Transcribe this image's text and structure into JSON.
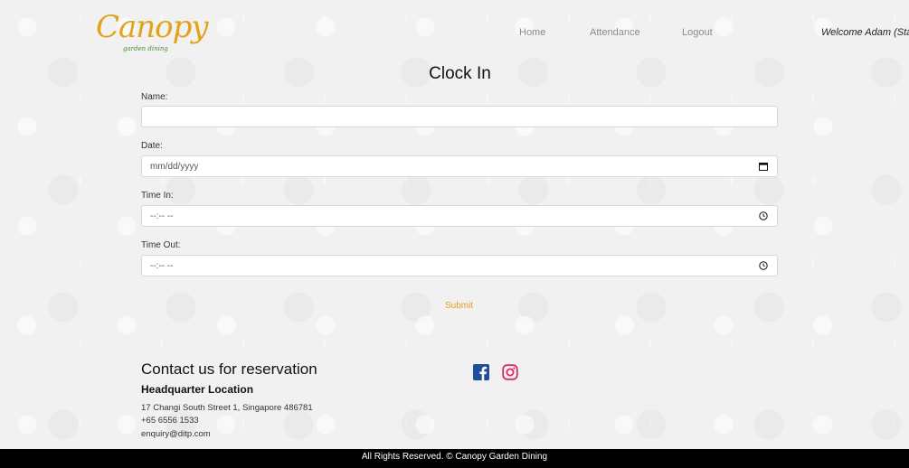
{
  "brand": {
    "logo_text": "Canopy",
    "logo_subtext": "garden dining"
  },
  "nav": {
    "items": [
      {
        "label": "Home"
      },
      {
        "label": "Attendance"
      },
      {
        "label": "Logout"
      }
    ],
    "welcome": "Welcome Adam (Staff"
  },
  "form": {
    "title": "Clock In",
    "name": {
      "label": "Name:",
      "value": ""
    },
    "date": {
      "label": "Date:",
      "placeholder": "mm/dd/yyyy",
      "icon": "calendar-icon"
    },
    "time_in": {
      "label": "Time In:",
      "placeholder": "--:-- --",
      "icon": "clock-icon"
    },
    "time_out": {
      "label": "Time Out:",
      "placeholder": "--:-- --",
      "icon": "clock-icon"
    },
    "submit_label": "Submit"
  },
  "contact": {
    "title": "Contact us for reservation",
    "hq_title": "Headquarter Location",
    "address": "17 Changi South Street 1, Singapore 486781",
    "phone": "+65 6556 1533",
    "email": "enquiry@ditp.com",
    "social": [
      "facebook-icon",
      "instagram-icon"
    ]
  },
  "footer": {
    "text": "All Rights Reserved. © Canopy Garden Dining"
  },
  "colors": {
    "accent": "#e3a020",
    "facebook": "#1f4f99",
    "instagram": "#d62d62",
    "footer_bg": "#000000"
  }
}
